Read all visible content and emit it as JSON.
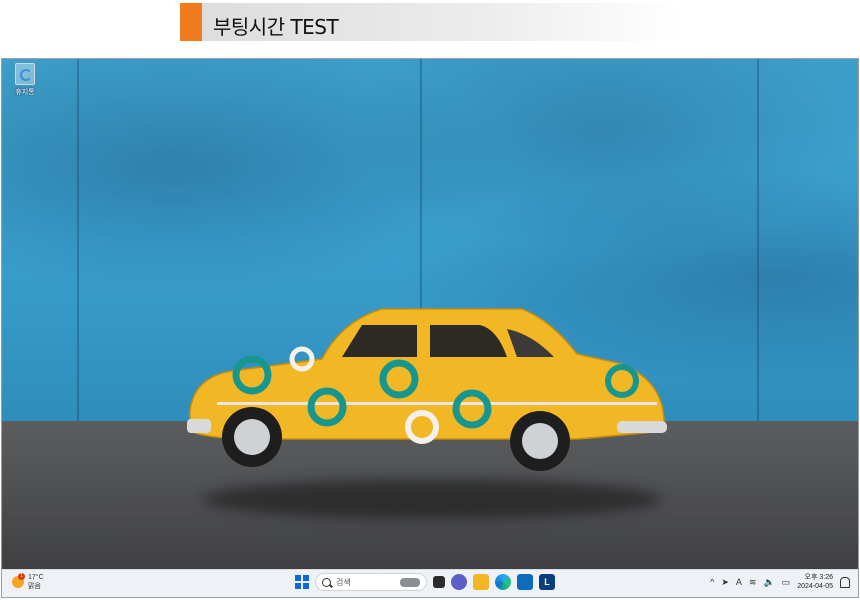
{
  "banner": {
    "title": "부팅시간 TEST"
  },
  "desktop": {
    "recycle_bin_label": "휴지통"
  },
  "taskbar": {
    "weather": {
      "badge": "1",
      "temp": "17°C",
      "condition": "맑음"
    },
    "search_placeholder": "검색",
    "app_letter": "L",
    "tray": {
      "chevron": "^",
      "ime": "A"
    },
    "clock": {
      "time": "오후 3:26",
      "date": "2024-04-05"
    }
  }
}
